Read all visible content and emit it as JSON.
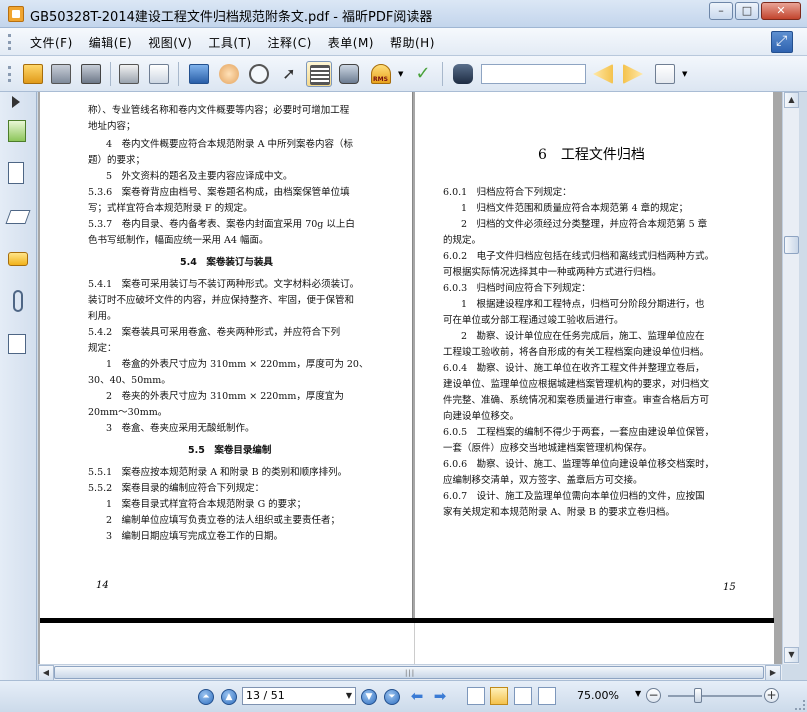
{
  "window": {
    "title": "GB50328T-2014建设工程文件归档规范附条文.pdf - 福昕PDF阅读器",
    "controls": [
      "minimize",
      "maximize",
      "close"
    ]
  },
  "menubar": {
    "items": [
      "文件(F)",
      "编辑(E)",
      "视图(V)",
      "工具(T)",
      "注释(C)",
      "表单(M)",
      "帮助(H)"
    ]
  },
  "toolbar": {
    "icons": [
      "open-icon",
      "save-icon",
      "save-as-icon",
      "print-icon",
      "email-icon",
      "fullscreen-icon",
      "hand-tool-icon",
      "snapshot-zoom-icon",
      "select-icon",
      "text-select-icon",
      "camera-icon",
      "rms-icon",
      "sign-icon",
      "search-icon",
      "prev-result-icon",
      "next-result-icon",
      "highlight-icon"
    ],
    "rms_label": "RMS",
    "search_value": ""
  },
  "document": {
    "left_page": {
      "lines": [
        "称）、专业管线名称和卷内文件概要等内容；必要时可增加工程",
        "地址内容；",
        "4　卷内文件概要应符合本规范附录 A 中所列案卷内容（标",
        "题）的要求；",
        "5　外文资料的题名及主要内容应译成中文。",
        "5.3.6　案卷脊背应由档号、案卷题名构成，由档案保管单位填",
        "写；式样宜符合本规范附录 F 的规定。",
        "5.3.7　卷内目录、卷内备考表、案卷内封面宜采用 70g 以上白",
        "色书写纸制作，幅面应统一采用 A4 幅面。",
        "5.4　案卷装订与装具",
        "5.4.1　案卷可采用装订与不装订两种形式。文字材料必须装订。",
        "装订时不应破坏文件的内容，并应保持整齐、牢固，便于保管和",
        "利用。",
        "5.4.2　案卷装具可采用卷盒、卷夹两种形式，并应符合下列",
        "规定：",
        "1　卷盒的外表尺寸应为 310mm × 220mm，厚度可为 20、",
        "30、40、50mm。",
        "2　卷夹的外表尺寸应为 310mm × 220mm，厚度宜为",
        "20mm～30mm。",
        "3　卷盒、卷夹应采用无酸纸制作。",
        "5.5　案卷目录编制",
        "5.5.1　案卷应按本规范附录 A 和附录 B 的类别和顺序排列。",
        "5.5.2　案卷目录的编制应符合下列规定：",
        "1　案卷目录式样宜符合本规范附录 G 的要求；",
        "2　编制单位应填写负责立卷的法人组织或主要责任者；",
        "3　编制日期应填写完成立卷工作的日期。"
      ],
      "page_number": "14"
    },
    "right_page": {
      "chapter_title": "6　工程文件归档",
      "lines": [
        "6.0.1　归档应符合下列规定：",
        "1　归档文件范围和质量应符合本规范第 4 章的规定；",
        "2　归档的文件必须经过分类整理，并应符合本规范第 5 章",
        "的规定。",
        "6.0.2　电子文件归档应包括在线式归档和离线式归档两种方式。",
        "可根据实际情况选择其中一种或两种方式进行归档。",
        "6.0.3　归档时间应符合下列规定：",
        "1　根据建设程序和工程特点，归档可分阶段分期进行，也",
        "可在单位或分部工程通过竣工验收后进行。",
        "2　勘察、设计单位应在任务完成后，施工、监理单位应在",
        "工程竣工验收前，将各自形成的有关工程档案向建设单位归档。",
        "6.0.4　勘察、设计、施工单位在收齐工程文件并整理立卷后，",
        "建设单位、监理单位应根据城建档案管理机构的要求，对归档文",
        "件完整、准确、系统情况和案卷质量进行审查。审查合格后方可",
        "向建设单位移交。",
        "6.0.5　工程档案的编制不得少于两套，一套应由建设单位保管，",
        "一套（原件）应移交当地城建档案管理机构保存。",
        "6.0.6　勘察、设计、施工、监理等单位向建设单位移交档案时，",
        "应编制移交清单，双方签字、盖章后方可交接。",
        "6.0.7　设计、施工及监理单位需向本单位归档的文件，应按国",
        "家有关规定和本规范附录 A、附录 B 的要求立卷归档。"
      ],
      "page_number": "15"
    }
  },
  "statusbar": {
    "page_input": "13 / 51",
    "zoom": "75.00%"
  },
  "colors": {
    "accent": "#2f6fc0",
    "title_bar": "#c3d5ec",
    "doc_background": "#a7a7a7"
  }
}
